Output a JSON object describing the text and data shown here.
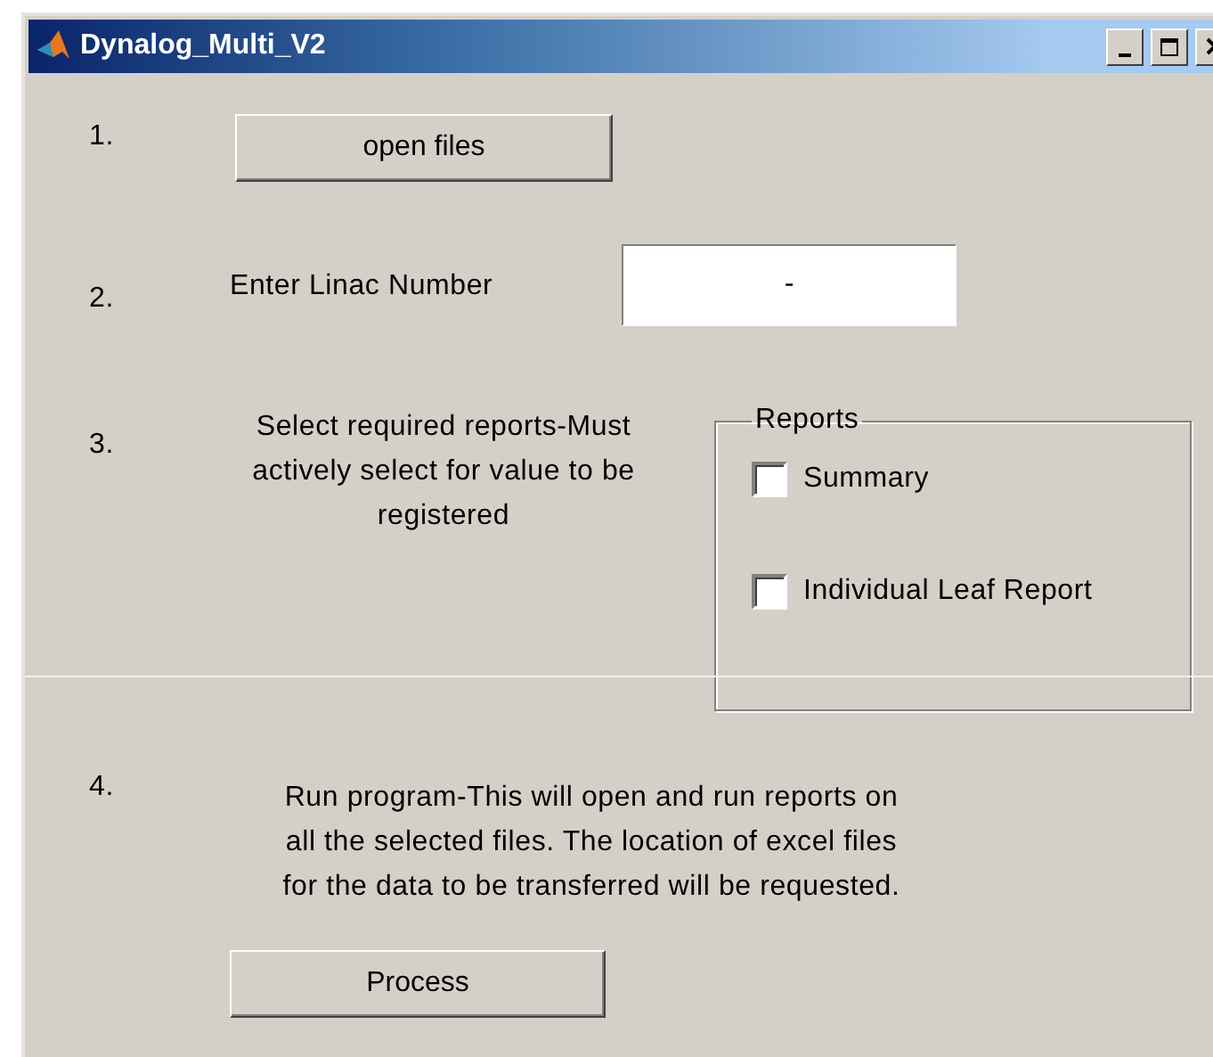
{
  "window": {
    "title": "Dynalog_Multi_V2"
  },
  "steps": [
    {
      "number": "1.",
      "kind": "button",
      "button": "open files"
    },
    {
      "number": "2.",
      "kind": "field",
      "label": "Enter Linac Number",
      "value": "-"
    },
    {
      "number": "3.",
      "kind": "group",
      "text": "Select required reports-Must actively select for value to be registered",
      "group": {
        "title": "Reports",
        "options": [
          {
            "label": "Summary",
            "checked": false
          },
          {
            "label": "Individual Leaf Report",
            "checked": false
          }
        ]
      }
    },
    {
      "number": "4.",
      "kind": "run",
      "text": "Run program-This will open and run reports on all the selected files. The location of excel files for the data to be transferred will be requested.",
      "button": "Process"
    }
  ]
}
